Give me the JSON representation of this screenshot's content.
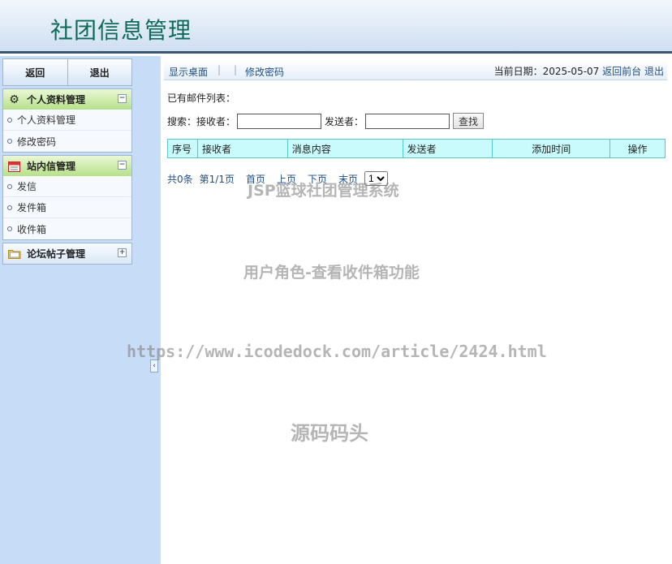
{
  "header": {
    "title": "社团信息管理"
  },
  "sidebar": {
    "buttons": {
      "back": "返回",
      "logout": "退出"
    },
    "groups": [
      {
        "title": "个人资料管理",
        "icon": "gear-icon",
        "toggle": "−",
        "items": [
          "个人资料管理",
          "修改密码"
        ]
      },
      {
        "title": "站内信管理",
        "icon": "calendar-icon",
        "toggle": "−",
        "items": [
          "发信",
          "发件箱",
          "收件箱"
        ]
      },
      {
        "title": "论坛帖子管理",
        "icon": "folder-icon",
        "toggle": "+",
        "items": []
      }
    ],
    "collapse_glyph": "‹"
  },
  "topbar": {
    "show_desktop": "显示桌面",
    "sep": "|",
    "change_password": "修改密码",
    "date_label": "当前日期：2025-05-07",
    "back_front": "返回前台",
    "logout": "退出"
  },
  "main": {
    "list_label": "已有邮件列表：",
    "search": {
      "label": "搜索：",
      "receiver_label": "接收者：",
      "sender_label": "发送者：",
      "receiver_value": "",
      "sender_value": "",
      "find_button": "查找"
    },
    "table": {
      "columns": [
        "序号",
        "接收者",
        "消息内容",
        "发送者",
        "添加时间",
        "操作"
      ]
    },
    "pager": {
      "total": "共0条",
      "page": "第1/1页",
      "first": "首页",
      "prev": "上页",
      "next": "下页",
      "last": "末页",
      "selected_page": "1"
    }
  },
  "watermarks": {
    "line1": "JSP篮球社团管理系统",
    "line2": "用户角色-查看收件箱功能",
    "line3": "https://www.icodedock.com/article/2424.html",
    "line4": "源码码头"
  }
}
